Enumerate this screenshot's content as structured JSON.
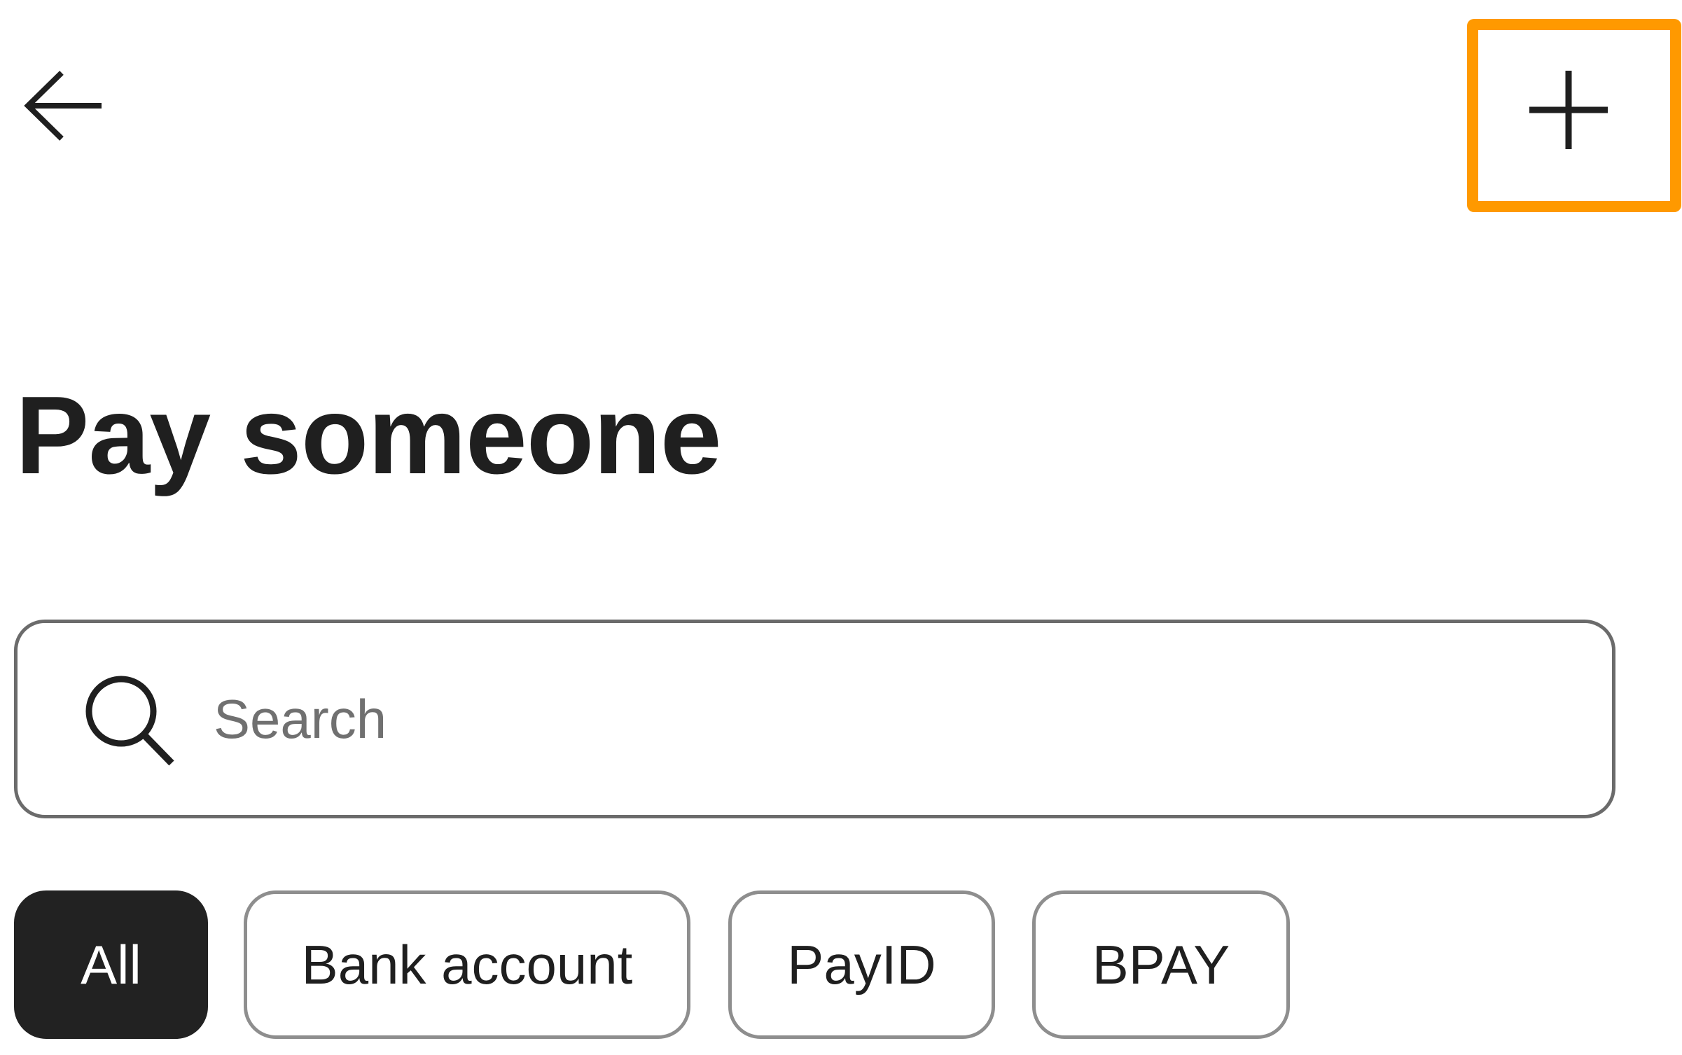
{
  "header": {
    "back_icon": "arrow-left-icon",
    "add_icon": "plus-icon",
    "highlight_color": "#ff9900"
  },
  "main": {
    "title": "Pay someone",
    "search": {
      "icon": "search-icon",
      "placeholder": "Search",
      "value": ""
    },
    "filters": [
      {
        "label": "All",
        "selected": true
      },
      {
        "label": "Bank account",
        "selected": false
      },
      {
        "label": "PayID",
        "selected": false
      },
      {
        "label": "BPAY",
        "selected": false
      }
    ],
    "colors": {
      "text": "#1f1f1f",
      "chip_selected_bg": "#222222",
      "chip_border": "#8e8e8e",
      "search_border": "#6b6b6b"
    }
  }
}
